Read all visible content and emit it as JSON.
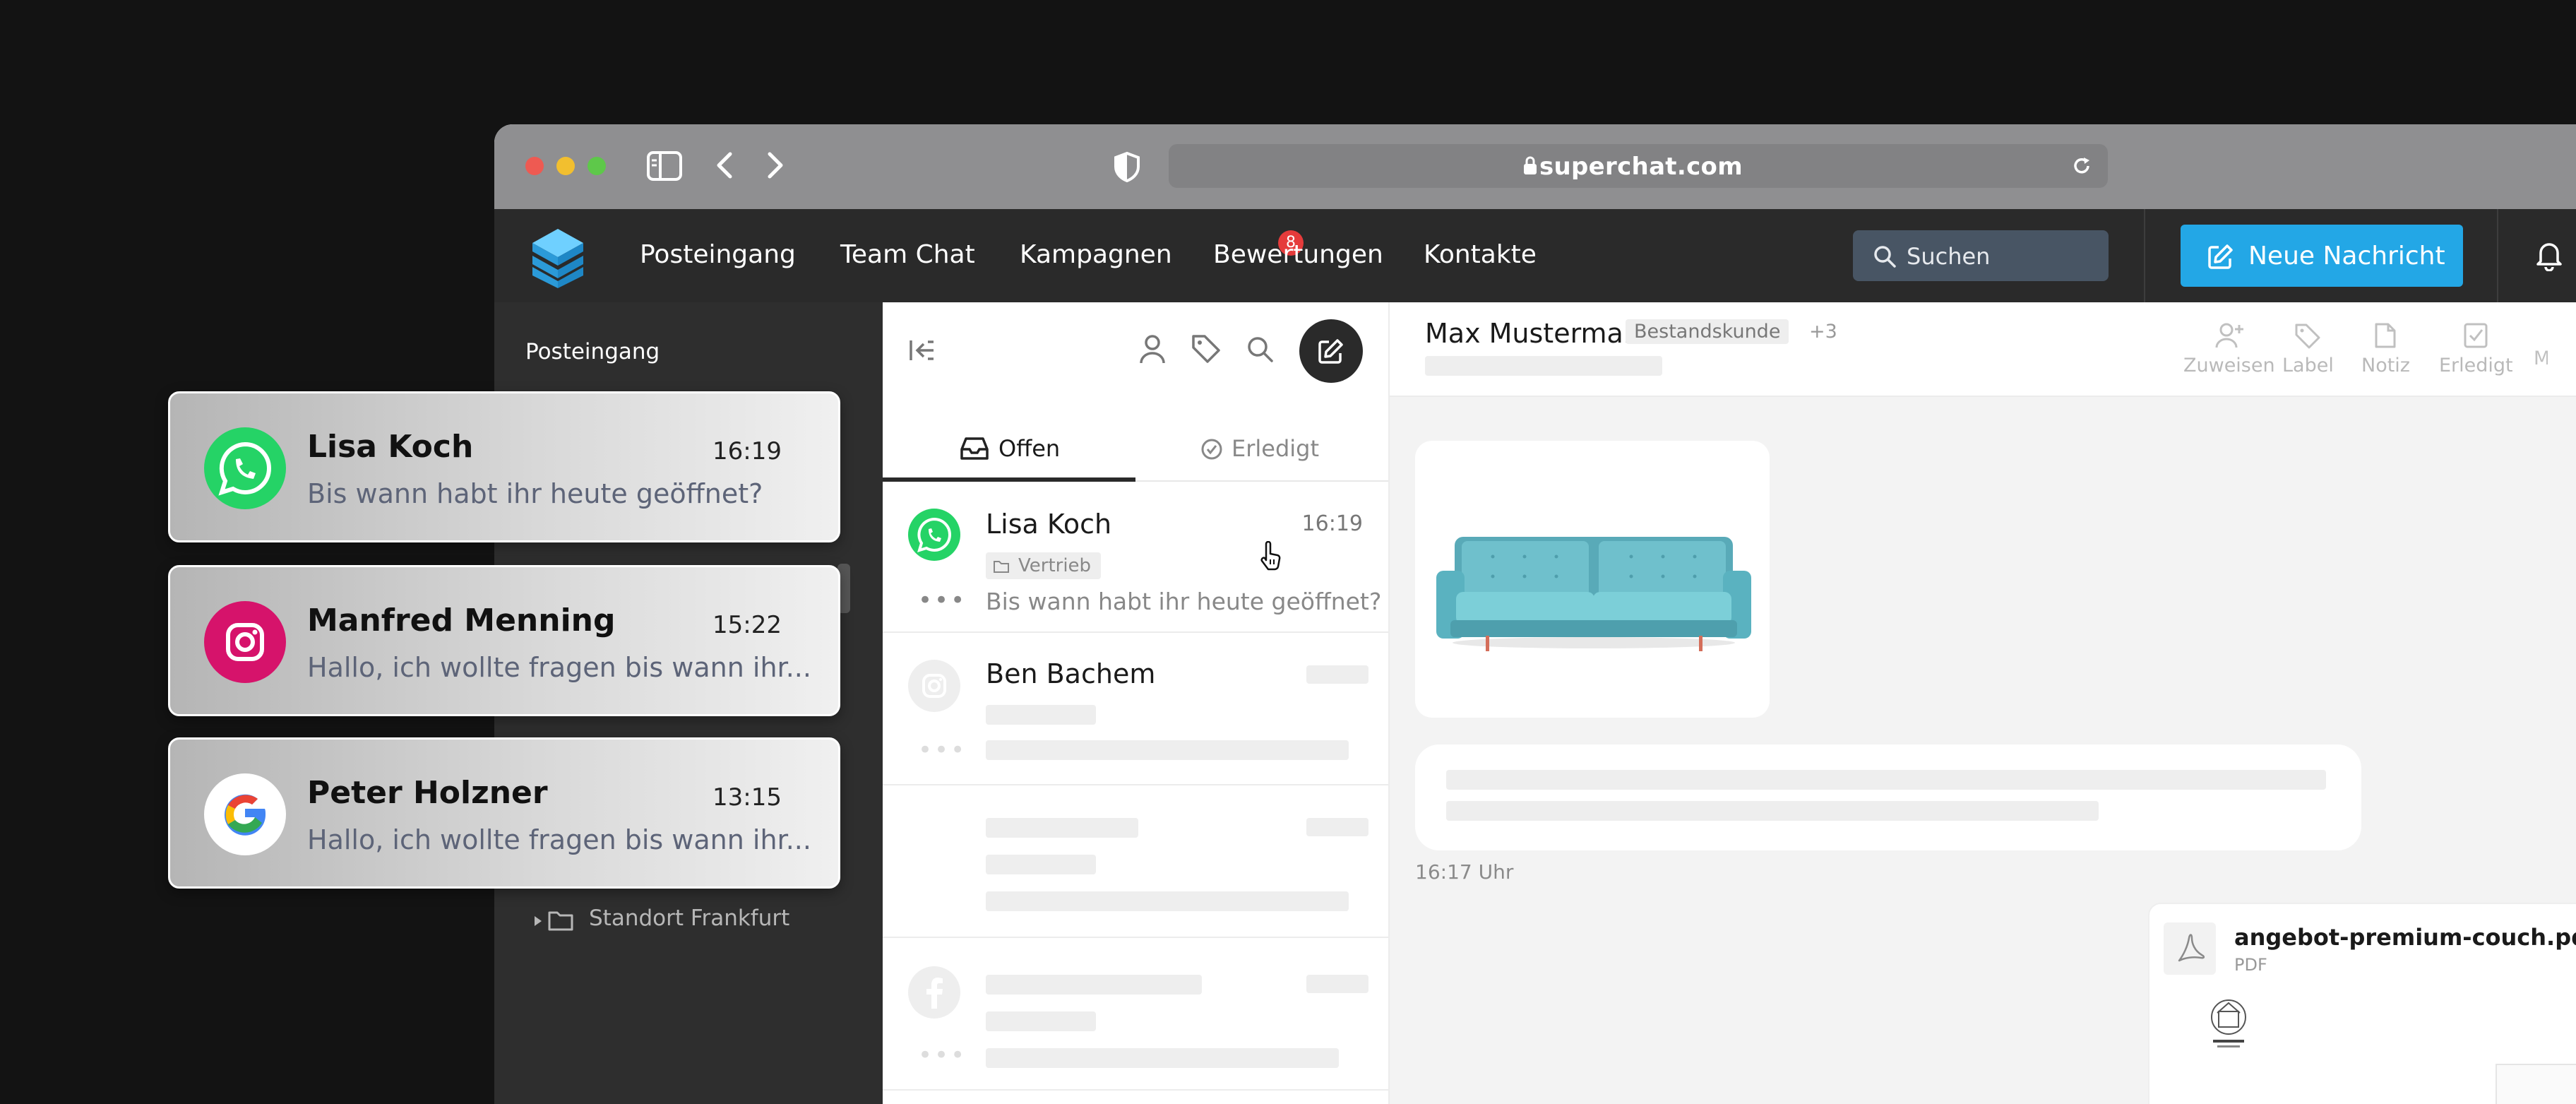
{
  "browser": {
    "url": "superchat.com"
  },
  "nav": {
    "items": [
      "Posteingang",
      "Team Chat",
      "Kampagnen",
      "Bewertungen",
      "Kontakte"
    ],
    "inbox_badge": "8",
    "search_placeholder": "Suchen",
    "new_message": "Neue Nachricht"
  },
  "sidebar": {
    "title": "Posteingang",
    "folder": "Standort Frankfurt"
  },
  "convlist": {
    "tabs": [
      "Offen",
      "Erledigt"
    ],
    "conversations": [
      {
        "name": "Lisa Koch",
        "time": "16:19",
        "tag": "Vertrieb",
        "preview": "Bis wann habt ihr heute geöffnet?",
        "channel": "whatsapp-icon"
      },
      {
        "name": "Ben Bachem",
        "channel": "instagram-icon"
      }
    ]
  },
  "chat": {
    "contact": "Max Mustermann",
    "contact_tag": "Bestandskunde",
    "contact_more": "+3",
    "actions": [
      "Zuweisen",
      "Label",
      "Notiz",
      "Erledigt"
    ],
    "message_time": "16:17 Uhr",
    "attachment": {
      "name": "angebot-premium-couch.pdf",
      "type": "PDF"
    }
  },
  "notifications": [
    {
      "name": "Lisa Koch",
      "time": "16:19",
      "message": "Bis wann habt ihr heute geöffnet?",
      "channel": "whatsapp-icon"
    },
    {
      "name": "Manfred Menning",
      "time": "15:22",
      "message": "Hallo, ich wollte fragen bis wann ihr...",
      "channel": "instagram-icon"
    },
    {
      "name": "Peter Holzner",
      "time": "13:15",
      "message": "Hallo, ich wollte fragen bis wann ihr...",
      "channel": "google-icon"
    }
  ],
  "colors": {
    "accent": "#23a7e6",
    "badge": "#e53b3b",
    "whatsapp": "#25d366",
    "instagram": "#d6136b"
  }
}
